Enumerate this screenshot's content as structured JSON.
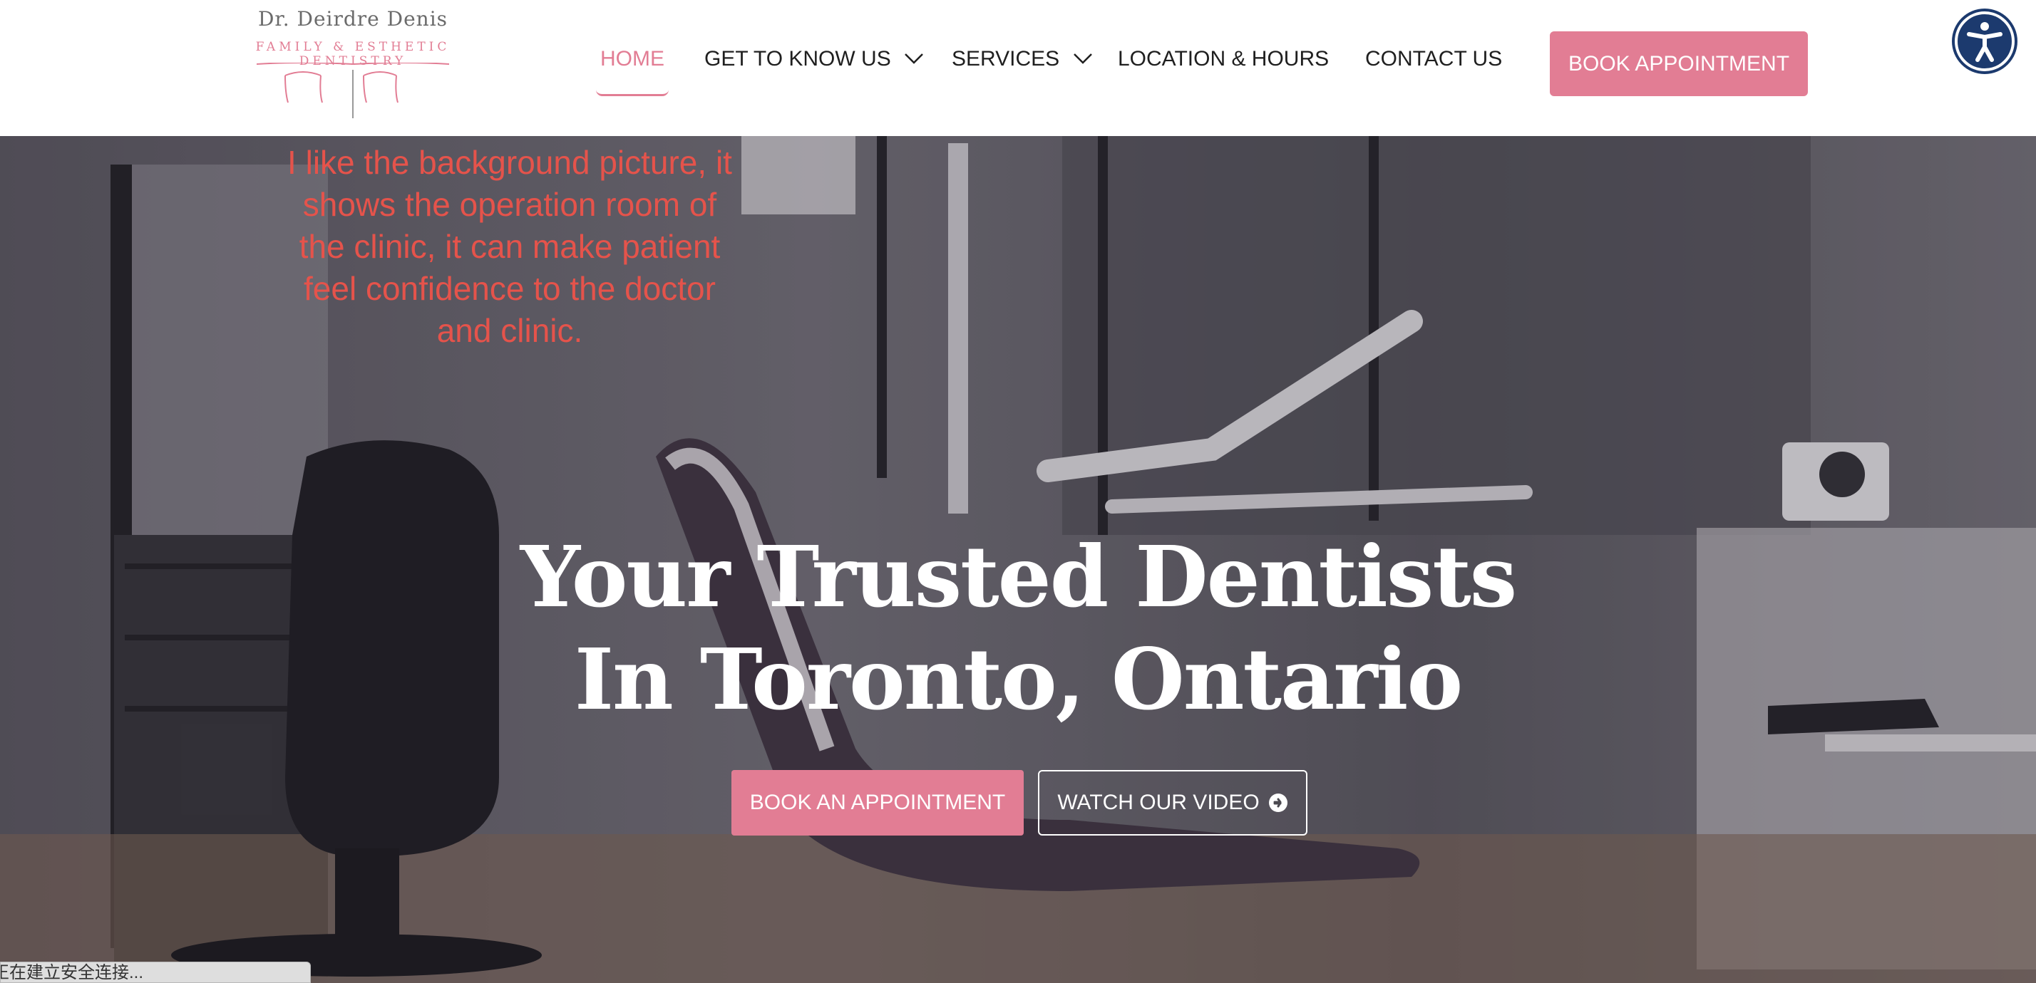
{
  "logo": {
    "name": "Dr. Deirdre Denis",
    "tagline": "FAMILY & ESTHETIC DENTISTRY"
  },
  "nav": {
    "items": [
      {
        "label": "HOME",
        "active": true
      },
      {
        "label": "GET TO KNOW US",
        "dropdown": true
      },
      {
        "label": "SERVICES",
        "dropdown": true
      },
      {
        "label": "LOCATION & HOURS"
      },
      {
        "label": "CONTACT US"
      }
    ],
    "book_button": "BOOK APPOINTMENT"
  },
  "accessibility": {
    "icon": "accessibility-icon"
  },
  "hero": {
    "annotation": "I like the background picture, it shows the operation room of the clinic, it can make patient feel confidence to the doctor and clinic.",
    "title_line1": "Your Trusted Dentists",
    "title_line2": "In Toronto, Ontario",
    "primary_button": "BOOK AN APPOINTMENT",
    "secondary_button": "WATCH OUR VIDEO"
  },
  "status_bar": {
    "text": "正在建立安全连接..."
  },
  "colors": {
    "accent": "#e27d94",
    "annotation": "#e5534b",
    "a11y": "#1c3a6e"
  }
}
